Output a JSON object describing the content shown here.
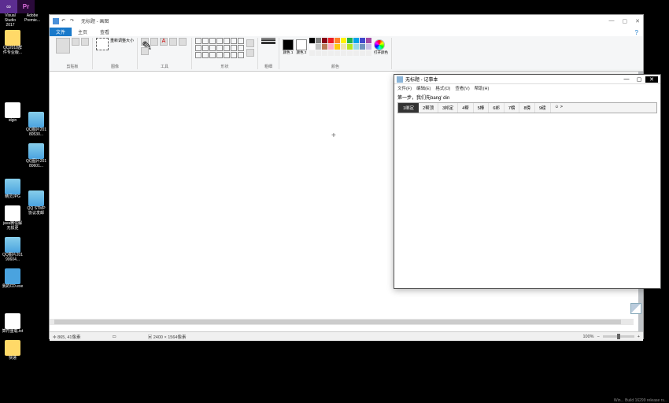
{
  "taskbar": {
    "vs_label": "Visual Studio 2017",
    "pr_label": "Adobe Premie..."
  },
  "desktop_icons": [
    "QQ2018群件专业版...",
    "idgin",
    "精灵JPG",
    "java微信解无损更",
    "QQ图片20190604...",
    "我的CD.exe",
    "算符重载.txt",
    "快递"
  ],
  "desktop_icons2": [
    "QQ图片20180530...",
    "QQ图片20180601...",
    "QQ STMP协议发邮"
  ],
  "paint": {
    "title": "无标题 - 画图",
    "tabs": {
      "file": "文件",
      "home": "主页",
      "view": "查看"
    },
    "groups": {
      "clipboard": "剪贴板",
      "image": "图像",
      "tools": "工具",
      "shapes": "形状",
      "size": "粗细",
      "colors": "颜色"
    },
    "image_tools": "重新调整大小",
    "color1": "颜色 1",
    "color2": "颜色 2",
    "edit_colors": "打开颜色",
    "status": {
      "pos": "865, 41像素",
      "size": "2400 × 1564像素",
      "zoom": "100%"
    },
    "help_icon": "?"
  },
  "notepad": {
    "title": "无标题 - 记事本",
    "menu": [
      "文件(F)",
      "编辑(E)",
      "格式(O)",
      "查看(V)",
      "帮助(H)"
    ],
    "text": "第一步，我们先bang' din",
    "ime_candidates": [
      "1绑定",
      "2帮顶",
      "3邦定",
      "4帮",
      "5棒",
      "6邦",
      "7榜",
      "8傍",
      "9磅"
    ],
    "ime_more": "☺ >"
  },
  "palette_colors": [
    "#000",
    "#7f7f7f",
    "#880015",
    "#ed1c24",
    "#ff7f27",
    "#fff200",
    "#22b14c",
    "#00a2e8",
    "#3f48cc",
    "#a349a4",
    "#fff",
    "#c3c3c3",
    "#b97a57",
    "#ffaec9",
    "#ffc90e",
    "#efe4b0",
    "#b5e61d",
    "#99d9ea",
    "#7092be",
    "#c8bfe7",
    "#eee",
    "#eee",
    "#eee",
    "#eee",
    "#eee",
    "#eee",
    "#eee",
    "#eee",
    "#eee",
    "#eee"
  ],
  "watermark": "Win... Build 16299 release rs..."
}
